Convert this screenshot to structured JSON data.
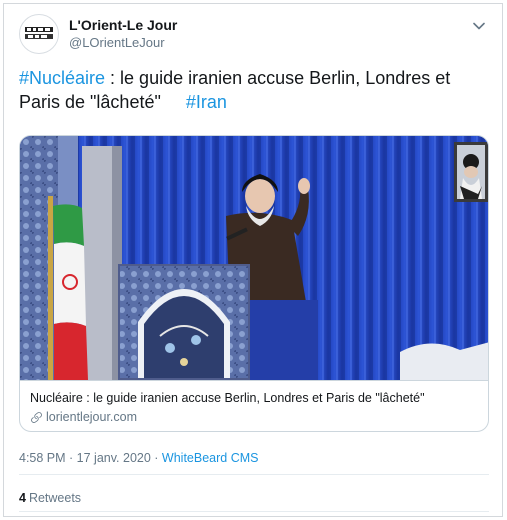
{
  "account": {
    "display_name": "L'Orient-Le Jour",
    "handle": "@LOrientLeJour",
    "avatar_icon": "lorient-le-jour-logo-icon"
  },
  "tweet": {
    "hashtag1": "#Nucléaire",
    "text": " : le guide iranien accuse Berlin, Londres et Paris de \"lâcheté\"",
    "hashtag2": "#Iran"
  },
  "card": {
    "image_description_icon": "photo-image",
    "title": "Nucléaire : le guide iranien accuse Berlin, Londres et Paris de \"lâcheté\"",
    "domain": "lorientlejour.com",
    "domain_icon": "link-icon"
  },
  "meta": {
    "time": "4:58 PM",
    "separator1": " · ",
    "date": "17 janv. 2020",
    "separator2": " · ",
    "source": "WhiteBeard CMS"
  },
  "stats": {
    "retweet_count": "4",
    "retweet_label": "Retweets"
  },
  "colors": {
    "link": "#1b95e0",
    "text": "#14171a",
    "muted": "#657786",
    "border": "#ccd6dd"
  }
}
